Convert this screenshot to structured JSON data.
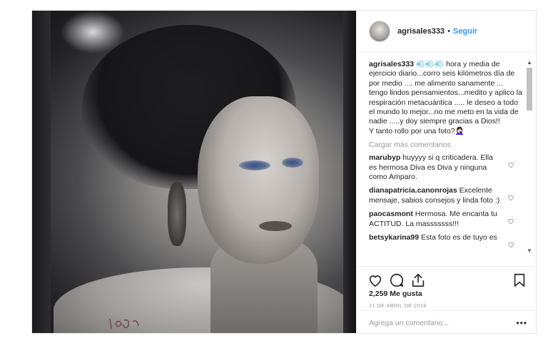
{
  "post": {
    "username": "agrisales333",
    "separator": "•",
    "follow_label": "Seguir",
    "caption_user": "agrisales333",
    "caption_text": " 💨💨💨 hora y media de ejercicio diario...corro seis kilómetros día de por medio .... me alimento sanamente ... tengo lindos pensamientos...medito y aplico la respiración metacuántica ..... le deseo a todo el mundo lo mejor...no me meto en la vida de nadie .....y doy siempre gracias a Dios!!",
    "caption_text_2": "Y tanto rollo por una foto?🤦🏻‍♀️",
    "load_more": "Cargar más comentarios",
    "comments": [
      {
        "user": "marubyp",
        "text": " huyyyy si q criticadera. Ella es hermosa Diva es Diva y ninguna como Amparo."
      },
      {
        "user": "dianapatricia.canonrojas",
        "text": " Excelente mensaje, sabios consejos y linda foto :)"
      },
      {
        "user": "paocasmont",
        "text": " Hermosa. Me encanta tu ACTITUD. La masssssss!!!"
      },
      {
        "user": "betsykarina99",
        "text": " Esta foto es de tuyo es"
      }
    ],
    "likes": "2,259 Me gusta",
    "date": "21 DE ABRIL DE 2016",
    "comment_placeholder": "Agrega un comentario...",
    "more_label": "•••"
  },
  "photo_signature": "Isac",
  "icons": {
    "like": "heart-icon",
    "comment": "comment-icon",
    "share": "share-icon",
    "save": "bookmark-icon",
    "comment_like": "heart-icon"
  },
  "colors": {
    "link": "#3897f0",
    "text": "#262626",
    "muted": "#999999",
    "border": "#efefef"
  }
}
